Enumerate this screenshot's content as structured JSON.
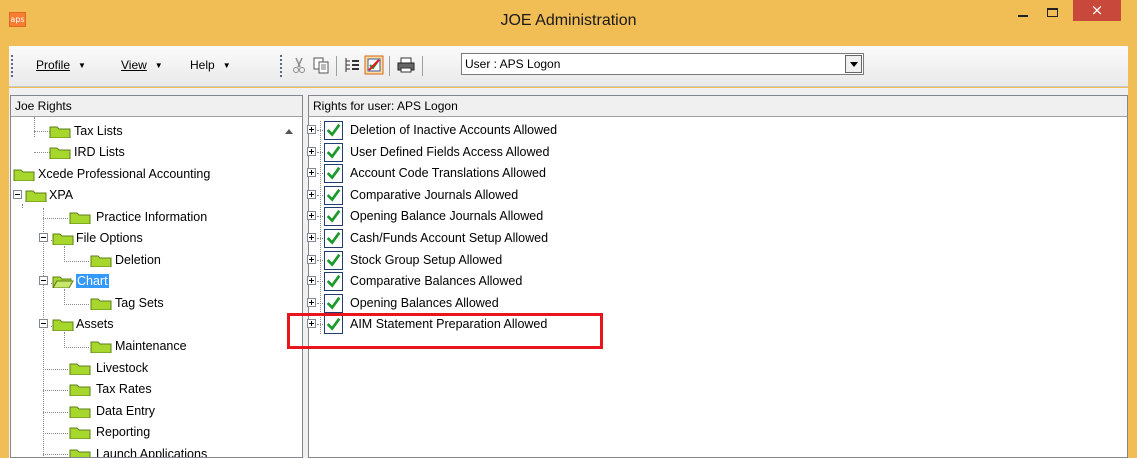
{
  "window": {
    "title": "JOE Administration",
    "app_icon_text": "aps",
    "close_glyph": "×"
  },
  "toolbar": {
    "menus": [
      {
        "label": "Profile"
      },
      {
        "label": "View"
      },
      {
        "label": "Help"
      }
    ],
    "user_select": {
      "value": "User : APS Logon"
    },
    "icons": [
      "cut-icon",
      "copy-icon",
      "tree-view-icon",
      "rights-icon",
      "print-icon"
    ]
  },
  "left_pane": {
    "header": "Joe Rights",
    "tree": [
      {
        "label": "Tax Lists",
        "level": 2
      },
      {
        "label": "IRD Lists",
        "level": 2
      },
      {
        "label": "Xcede Professional Accounting",
        "level": 0
      },
      {
        "label": "XPA",
        "level": 0
      },
      {
        "label": "Practice Information",
        "level": 1
      },
      {
        "label": "File Options",
        "level": 1
      },
      {
        "label": "Deletion",
        "level": 2
      },
      {
        "label": "Chart",
        "level": 1,
        "selected": true
      },
      {
        "label": "Tag Sets",
        "level": 2
      },
      {
        "label": "Assets",
        "level": 1
      },
      {
        "label": "Maintenance",
        "level": 2
      },
      {
        "label": "Livestock",
        "level": 1
      },
      {
        "label": "Tax Rates",
        "level": 1
      },
      {
        "label": "Data Entry",
        "level": 1
      },
      {
        "label": "Reporting",
        "level": 1
      },
      {
        "label": "Launch Applications",
        "level": 1
      }
    ]
  },
  "right_pane": {
    "header": "Rights for user: APS Logon",
    "rights": [
      {
        "label": "Deletion of Inactive Accounts Allowed",
        "checked": true
      },
      {
        "label": "User Defined Fields Access Allowed",
        "checked": true
      },
      {
        "label": "Account Code Translations Allowed",
        "checked": true
      },
      {
        "label": "Comparative Journals Allowed",
        "checked": true
      },
      {
        "label": "Opening Balance Journals Allowed",
        "checked": true
      },
      {
        "label": "Cash/Funds Account Setup Allowed",
        "checked": true
      },
      {
        "label": "Stock Group Setup Allowed",
        "checked": true
      },
      {
        "label": "Comparative Balances Allowed",
        "checked": true
      },
      {
        "label": "Opening Balances Allowed",
        "checked": true
      },
      {
        "label": "AIM Statement Preparation Allowed",
        "checked": true
      }
    ]
  },
  "colors": {
    "title_bar": "#f1bd55",
    "selection": "#3399ff",
    "highlight_box": "#e8141e",
    "check": "#1a9a2a"
  }
}
